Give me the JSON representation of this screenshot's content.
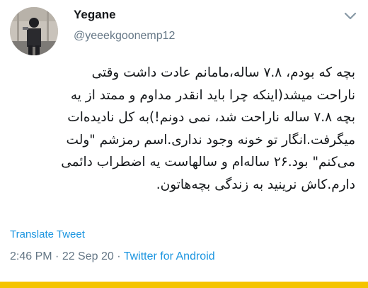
{
  "user": {
    "display_name": "Yegane",
    "handle": "@yeeekgoonemp12"
  },
  "icons": {
    "menu": "chevron-down-icon"
  },
  "tweet": {
    "lines": [
      "بچه که بودم، ۷.۸ ساله،مامانم عادت داشت وقتی",
      "ناراحت میشد(اینکه چرا باید انقدر مداوم و ممتد از یه",
      "بچه ۷.۸ ساله ناراحت شد، نمی دونم!)به کل نادیده‌ات",
      "میگرفت.انگار تو خونه وجود نداری.اسم رمزشم \"ولت",
      "می‌کنم\" بود.۲۶ ساله‌ام و سالهاست یه اضطراب دائمی",
      "دارم.کاش نرینید به زندگی بچه‌هاتون."
    ]
  },
  "translate_label": "Translate Tweet",
  "meta": {
    "time": "2:46 PM",
    "separator": " · ",
    "date": "22 Sep 20",
    "source": "Twitter for Android"
  },
  "colors": {
    "link": "#1b95e0",
    "secondary_text": "#657786",
    "bottom_bar": "#f5c400"
  }
}
